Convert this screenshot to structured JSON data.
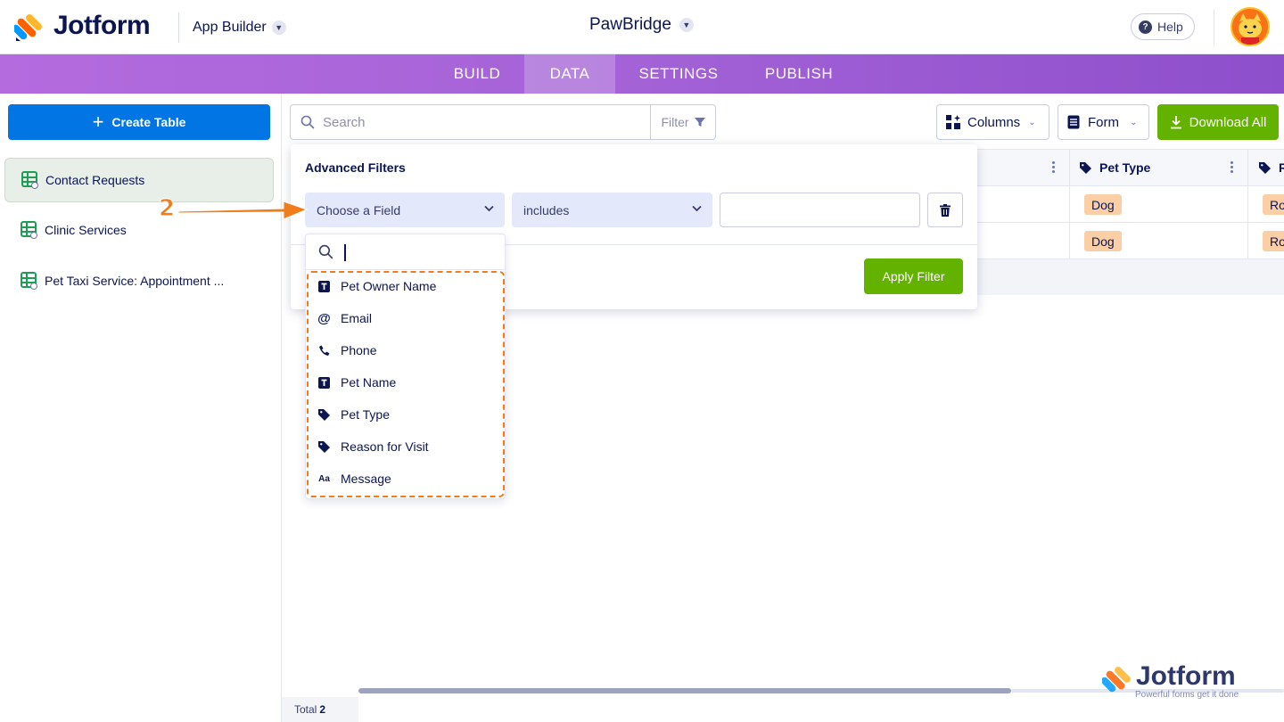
{
  "header": {
    "brand": "Jotform",
    "product": "App Builder",
    "app_name": "PawBridge",
    "help_label": "Help"
  },
  "nav": {
    "tabs": [
      {
        "label": "BUILD"
      },
      {
        "label": "DATA",
        "active": true
      },
      {
        "label": "SETTINGS"
      },
      {
        "label": "PUBLISH"
      }
    ]
  },
  "sidebar": {
    "create_label": "Create Table",
    "items": [
      {
        "label": "Contact Requests",
        "active": true
      },
      {
        "label": "Clinic Services"
      },
      {
        "label": "Pet Taxi Service: Appointment ..."
      }
    ]
  },
  "toolbar": {
    "search_placeholder": "Search",
    "filter_label": "Filter",
    "columns_label": "Columns",
    "form_label": "Form",
    "download_label": "Download All"
  },
  "table": {
    "col_pet_type": "Pet Type",
    "col_next_partial": "R",
    "rows": [
      {
        "pet_type": "Dog",
        "next_partial": "Ro"
      },
      {
        "pet_type": "Dog",
        "next_partial": "Ro"
      }
    ]
  },
  "filter_panel": {
    "title": "Advanced Filters",
    "field_placeholder": "Choose a Field",
    "operator": "includes",
    "value": "",
    "apply_label": "Apply Filter"
  },
  "field_dropdown": {
    "options": [
      {
        "label": "Pet Owner Name",
        "icon": "text-field-icon"
      },
      {
        "label": "Email",
        "icon": "at-icon"
      },
      {
        "label": "Phone",
        "icon": "phone-icon"
      },
      {
        "label": "Pet Name",
        "icon": "text-field-icon"
      },
      {
        "label": "Pet Type",
        "icon": "tag-icon"
      },
      {
        "label": "Reason for Visit",
        "icon": "tag-icon"
      },
      {
        "label": "Message",
        "icon": "long-text-icon"
      }
    ]
  },
  "annotation": {
    "step": "2"
  },
  "footer": {
    "total_label": "Total",
    "total_value": "2"
  },
  "watermark": {
    "brand": "Jotform",
    "tagline": "Powerful forms get it done"
  },
  "colors": {
    "primary_blue": "#0075e3",
    "green": "#64b200",
    "navy": "#0a1551",
    "nav_purple": "#a362d6",
    "annotation_orange": "#f07c1b",
    "pill_orange": "#fbcfa6"
  }
}
